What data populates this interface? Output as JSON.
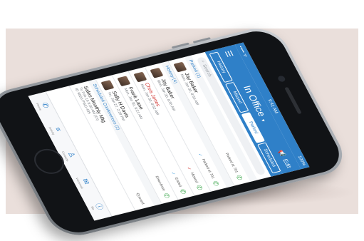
{
  "status_bar": {
    "carrier": "••••• ᯤ",
    "time": "9:41 AM",
    "battery": "100%"
  },
  "nav": {
    "title": "In Office",
    "title_caret": "▾",
    "edit_label": "Edit"
  },
  "tabs": [
    {
      "label": "History",
      "active": false
    },
    {
      "label": "Missed",
      "active": false
    },
    {
      "label": "Parked",
      "active": true
    },
    {
      "label": "Scheduled",
      "active": false
    }
  ],
  "search": {
    "placeholder": "Search"
  },
  "sections": {
    "parked": "Parked (1)",
    "history": "History (4)",
    "scheduled": "Scheduled Conferences (2)"
  },
  "parked_rows": [
    {
      "name": "Jay Baker",
      "date": "Mon, Jan 30, 8:56 AM",
      "status": "Parked at 701",
      "status_icon": "",
      "missed": false
    }
  ],
  "history_rows": [
    {
      "name": "Jay Baker",
      "date": "Mon, Jan 30, 8:56 AM",
      "status": "Parked at 701",
      "status_icon": "✓",
      "missed": false
    },
    {
      "name": "Chris Jones",
      "date": "Mon, Jan 30, 8:52 AM",
      "status": "Missed",
      "status_icon": "✓",
      "missed": true
    },
    {
      "name": "Frank Lane",
      "date": "Mon, Jan 30, 8:21 AM",
      "status": "Ended",
      "status_icon": "✓",
      "missed": false
    },
    {
      "name": "Sally H Davis",
      "date": "Fri, Jan 27, 2:39 PM",
      "status": "Elsewhere",
      "status_icon": "",
      "missed": false
    }
  ],
  "scheduled_rows": [
    {
      "name": "Sales Monthly Mtg",
      "date": "Tu Feb 16 8:00 AM (1h)",
      "detail": "ID 9820  PWD 495",
      "status": "Queued"
    }
  ],
  "tabbar": [
    {
      "label": "Phone",
      "icon": "phone-handset-icon"
    },
    {
      "label": "Activity",
      "icon": "list-icon"
    },
    {
      "label": "Contacts",
      "icon": "contacts-icon"
    },
    {
      "label": "Voicemail",
      "icon": "envelope-icon"
    },
    {
      "label": "Me",
      "icon": "info-icon"
    }
  ],
  "colors": {
    "accent": "#2f80c8",
    "missed": "#d0332f",
    "call_green": "#3aa64a",
    "background": "#eadfdb"
  }
}
